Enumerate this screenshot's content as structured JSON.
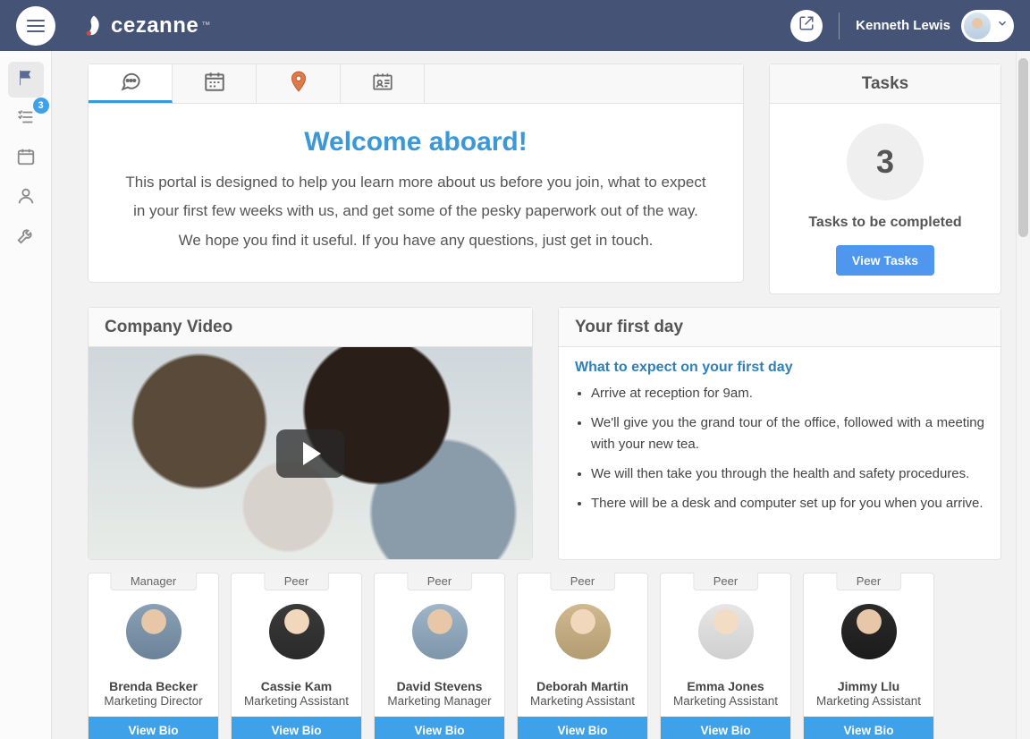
{
  "header": {
    "brand": "cezanne",
    "user_name": "Kenneth Lewis"
  },
  "rail": {
    "badge_count": "3"
  },
  "welcome": {
    "title": "Welcome aboard!",
    "text": "This portal is designed to help you learn more about us before you join, what to expect in your first few weeks with us, and get some of the pesky paperwork out of the way. We hope you find it useful. If you have any questions, just get in touch."
  },
  "tasks": {
    "heading": "Tasks",
    "count": "3",
    "label": "Tasks to be completed",
    "button": "View Tasks"
  },
  "video": {
    "heading": "Company Video"
  },
  "firstday": {
    "heading": "Your first day",
    "link": "What to expect on your first day",
    "items": [
      "Arrive at reception for 9am.",
      "We'll give you the grand tour of the office, followed with a meeting with your new tea.",
      "We will then take you through the health and safety procedures.",
      "There will be a desk and computer set up for you when you arrive."
    ]
  },
  "people": [
    {
      "role": "Manager",
      "name": "Brenda Becker",
      "title": "Marketing Director",
      "button": "View Bio",
      "tint": "tint1"
    },
    {
      "role": "Peer",
      "name": "Cassie Kam",
      "title": "Marketing Assistant",
      "button": "View Bio",
      "tint": "tint2"
    },
    {
      "role": "Peer",
      "name": "David Stevens",
      "title": "Marketing Manager",
      "button": "View Bio",
      "tint": "tint3"
    },
    {
      "role": "Peer",
      "name": "Deborah Martin",
      "title": "Marketing Assistant",
      "button": "View Bio",
      "tint": "tint4"
    },
    {
      "role": "Peer",
      "name": "Emma Jones",
      "title": "Marketing Assistant",
      "button": "View Bio",
      "tint": "tint5"
    },
    {
      "role": "Peer",
      "name": "Jimmy Llu",
      "title": "Marketing Assistant",
      "button": "View Bio",
      "tint": "tint6"
    }
  ]
}
